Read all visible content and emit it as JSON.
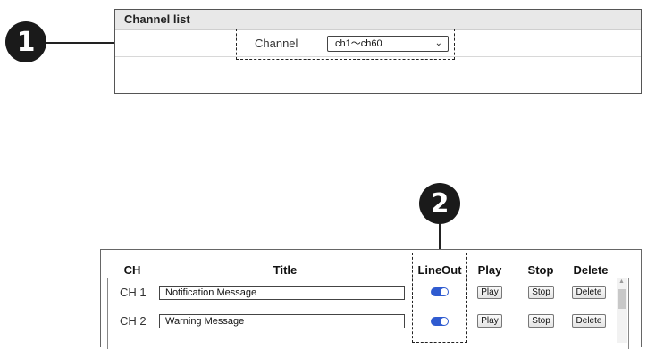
{
  "callouts": [
    {
      "number": "1"
    },
    {
      "number": "2"
    }
  ],
  "channel_list": {
    "title": "Channel list",
    "channel_label": "Channel",
    "channel_select_value": "ch1～ch60"
  },
  "table": {
    "headers": {
      "ch": "CH",
      "title": "Title",
      "lineout": "LineOut",
      "play": "Play",
      "stop": "Stop",
      "delete": "Delete"
    },
    "rows": [
      {
        "ch": "CH 1",
        "title": "Notification Message",
        "lineout_on": true,
        "play": "Play",
        "stop": "Stop",
        "delete": "Delete"
      },
      {
        "ch": "CH 2",
        "title": "Warning Message",
        "lineout_on": true,
        "play": "Play",
        "stop": "Stop",
        "delete": "Delete"
      }
    ]
  },
  "colors": {
    "toggle_on": "#2f5bd0",
    "badge": "#1a1a1a"
  },
  "icons": [
    "chevron-down-icon",
    "scroll-up-arrow-icon"
  ]
}
